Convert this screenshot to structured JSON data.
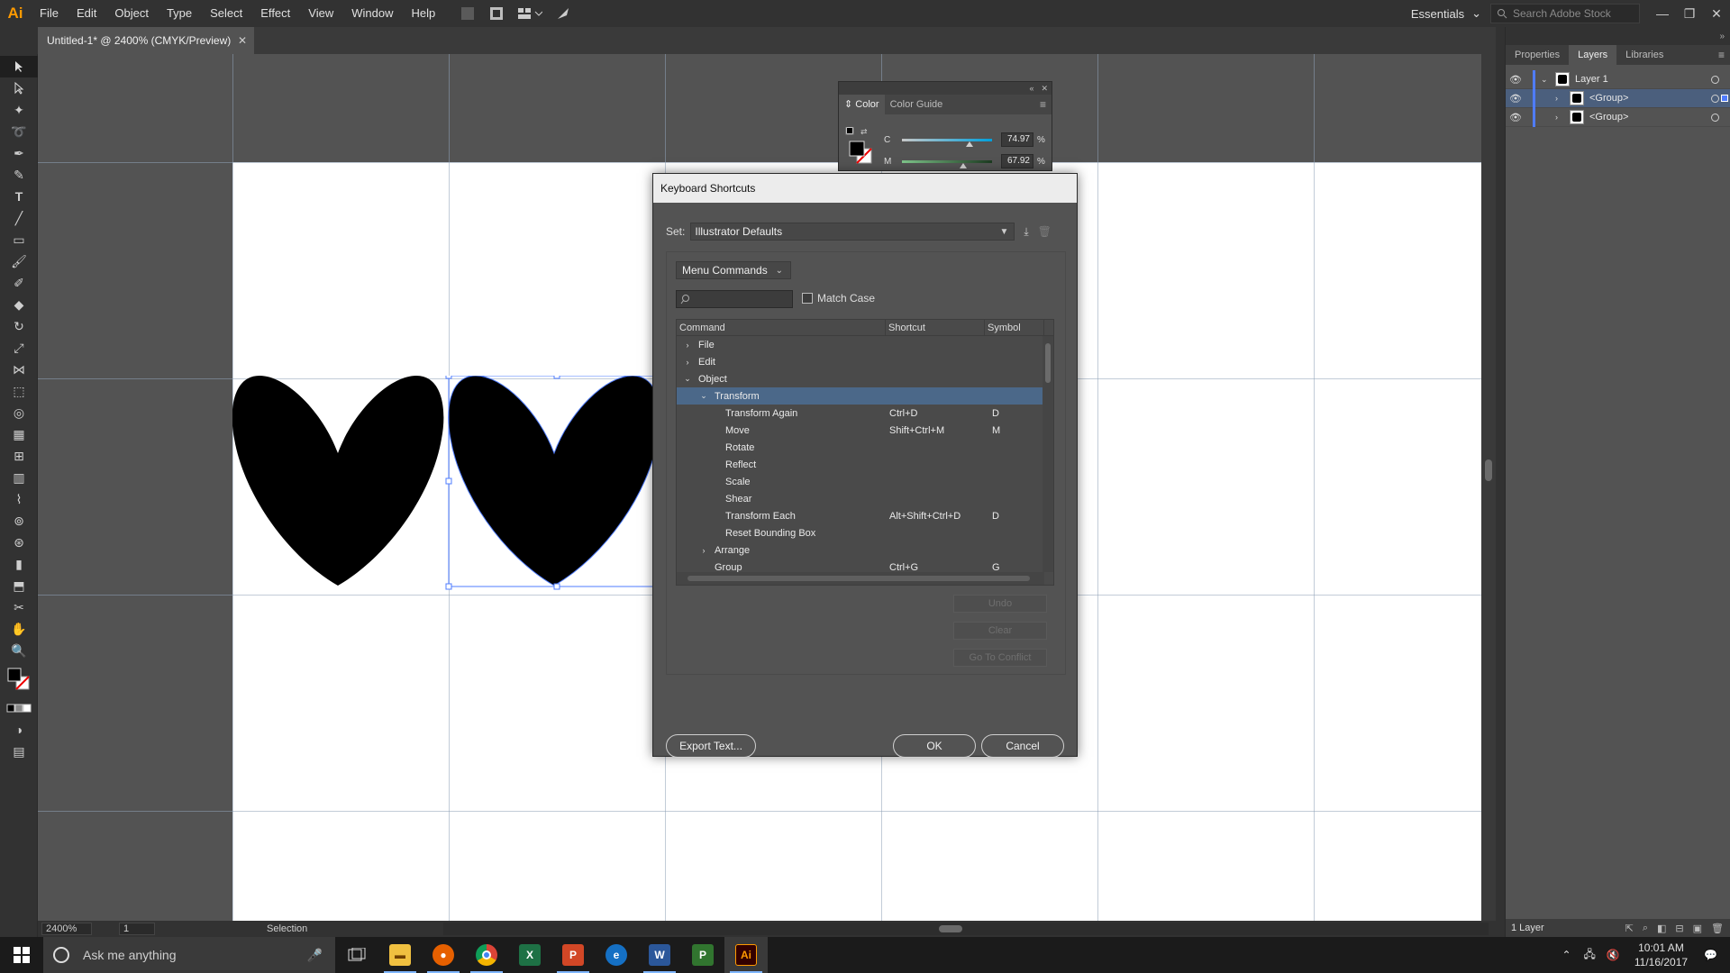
{
  "app": {
    "logo": "Ai",
    "menu": [
      "File",
      "Edit",
      "Object",
      "Type",
      "Select",
      "Effect",
      "View",
      "Window",
      "Help"
    ],
    "workspace": "Essentials",
    "stock_placeholder": "Search Adobe Stock"
  },
  "document": {
    "tab_title": "Untitled-1* @ 2400% (CMYK/Preview)"
  },
  "status": {
    "zoom": "2400%",
    "page": "1",
    "tool": "Selection"
  },
  "right_panel": {
    "tabs": [
      "Properties",
      "Layers",
      "Libraries"
    ],
    "layers": [
      {
        "name": "Layer 1"
      },
      {
        "name": "<Group>"
      },
      {
        "name": "<Group>"
      }
    ],
    "footer": "1 Layer"
  },
  "color_panel": {
    "tabs": [
      "Color",
      "Color Guide"
    ],
    "c_label": "C",
    "c_value": "74.97",
    "c_level": 0.7497,
    "m_label": "M",
    "m_value": "67.92",
    "m_level": 0.6792,
    "pct": "%"
  },
  "dialog": {
    "title": "Keyboard Shortcuts",
    "set_label": "Set:",
    "set_value": "Illustrator Defaults",
    "category": "Menu Commands",
    "search_icon": "magnifier-icon",
    "match_case": "Match Case",
    "columns": {
      "command": "Command",
      "shortcut": "Shortcut",
      "symbol": "Symbol"
    },
    "rows": [
      {
        "command": "File",
        "shortcut": "",
        "symbol": "",
        "level": 0,
        "expander": "collapsed"
      },
      {
        "command": "Edit",
        "shortcut": "",
        "symbol": "",
        "level": 0,
        "expander": "collapsed"
      },
      {
        "command": "Object",
        "shortcut": "",
        "symbol": "",
        "level": 0,
        "expander": "expanded"
      },
      {
        "command": "Transform",
        "shortcut": "",
        "symbol": "",
        "level": 1,
        "expander": "expanded",
        "selected": true
      },
      {
        "command": "Transform Again",
        "shortcut": "Ctrl+D",
        "symbol": "D",
        "level": 2,
        "expander": "none"
      },
      {
        "command": "Move",
        "shortcut": "Shift+Ctrl+M",
        "symbol": "M",
        "level": 2,
        "expander": "none"
      },
      {
        "command": "Rotate",
        "shortcut": "",
        "symbol": "",
        "level": 2,
        "expander": "none"
      },
      {
        "command": "Reflect",
        "shortcut": "",
        "symbol": "",
        "level": 2,
        "expander": "none"
      },
      {
        "command": "Scale",
        "shortcut": "",
        "symbol": "",
        "level": 2,
        "expander": "none"
      },
      {
        "command": "Shear",
        "shortcut": "",
        "symbol": "",
        "level": 2,
        "expander": "none"
      },
      {
        "command": "Transform Each",
        "shortcut": "Alt+Shift+Ctrl+D",
        "symbol": "D",
        "level": 2,
        "expander": "none"
      },
      {
        "command": "Reset Bounding Box",
        "shortcut": "",
        "symbol": "",
        "level": 2,
        "expander": "none"
      },
      {
        "command": "Arrange",
        "shortcut": "",
        "symbol": "",
        "level": 1,
        "expander": "collapsed"
      },
      {
        "command": "Group",
        "shortcut": "Ctrl+G",
        "symbol": "G",
        "level": 1,
        "expander": "none"
      }
    ],
    "undo": "Undo",
    "clear": "Clear",
    "go_to_conflict": "Go To Conflict",
    "export_text": "Export Text...",
    "ok": "OK",
    "cancel": "Cancel"
  },
  "taskbar": {
    "search_placeholder": "Ask me anything",
    "time": "10:01 AM",
    "date": "11/16/2017"
  },
  "colors": {
    "accent": "#4f7cff",
    "selection": "#4b6889",
    "ai_orange": "#ff9a00"
  }
}
